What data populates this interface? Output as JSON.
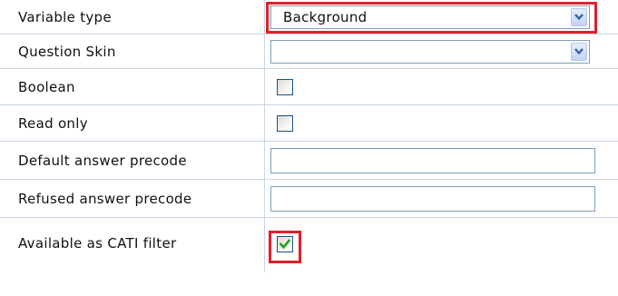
{
  "properties": [
    {
      "label": "Variable type",
      "control": "select",
      "value": "Background"
    },
    {
      "label": "Question Skin",
      "control": "select",
      "value": ""
    },
    {
      "label": "Boolean",
      "control": "checkbox",
      "checked": false
    },
    {
      "label": "Read only",
      "control": "checkbox",
      "checked": false
    },
    {
      "label": "Default answer precode",
      "control": "textbox",
      "value": ""
    },
    {
      "label": "Refused answer precode",
      "control": "textbox",
      "value": ""
    },
    {
      "label": "Available as CATI filter",
      "control": "checkbox",
      "checked": true
    }
  ],
  "icons": {
    "dropdown": "chevron-down-icon",
    "check": "checkmark-icon"
  },
  "colors": {
    "highlight": "#e0202a",
    "grid_line": "#c9d6e6",
    "check_mark": "#21a121",
    "dropdown_arrow": "#3a5fa8"
  }
}
